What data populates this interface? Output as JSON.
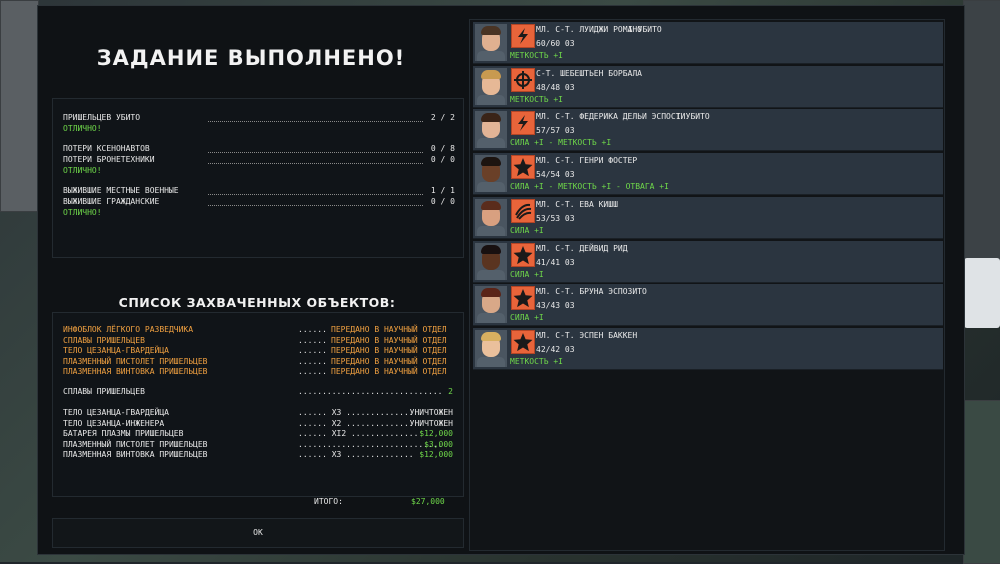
{
  "title": "ЗАДАНИЕ ВЫПОЛНЕНО!",
  "stats": {
    "aliens_killed": {
      "label": "ПРИШЕЛЬЦЕВ УБИТО",
      "value": "2 / 2",
      "rating": "ОТЛИЧНО!"
    },
    "xenonaut_losses": {
      "label": "ПОТЕРИ КСЕНОНАВТОВ",
      "value": "0 / 8"
    },
    "vehicle_losses": {
      "label": "ПОТЕРИ БРОНЕТЕХНИКИ",
      "value": "0 / 0",
      "rating": "ОТЛИЧНО!"
    },
    "local_military": {
      "label": "ВЫЖИВШИЕ МЕСТНЫЕ ВОЕННЫЕ",
      "value": "1 / 1"
    },
    "civilians": {
      "label": "ВЫЖИВШИЕ ГРАЖДАНСКИЕ",
      "value": "0 / 0",
      "rating": "ОТЛИЧНО!"
    }
  },
  "captured": {
    "title": "СПИСОК ЗАХВАЧЕННЫХ ОБЪЕКТОВ:",
    "research": [
      {
        "name": "ИНФОБЛОК ЛЁГКОГО РАЗВЕДЧИКА",
        "dots": "......",
        "status": "ПЕРЕДАНО В НАУЧНЫЙ ОТДЕЛ"
      },
      {
        "name": "СПЛАВЫ ПРИШЕЛЬЦЕВ",
        "dots": "......",
        "status": "ПЕРЕДАНО В НАУЧНЫЙ ОТДЕЛ"
      },
      {
        "name": "ТЕЛО ЦЕЗАНЦА-ГВАРДЕЙЦА",
        "dots": "......",
        "status": "ПЕРЕДАНО В НАУЧНЫЙ ОТДЕЛ"
      },
      {
        "name": "ПЛАЗМЕННЫЙ ПИСТОЛЕТ ПРИШЕЛЬЦЕВ",
        "dots": "......",
        "status": "ПЕРЕДАНО В НАУЧНЫЙ ОТДЕЛ"
      },
      {
        "name": "ПЛАЗМЕННАЯ ВИНТОВКА ПРИШЕЛЬЦЕВ",
        "dots": "......",
        "status": "ПЕРЕДАНО В НАУЧНЫЙ ОТДЕЛ"
      }
    ],
    "alloys": {
      "name": "СПЛАВЫ ПРИШЕЛЬЦЕВ",
      "dots": "..............................",
      "value": "2"
    },
    "sold": [
      {
        "name": "ТЕЛО ЦЕЗАНЦА-ГВАРДЕЙЦА",
        "qty": "...... X3 ..............",
        "result": "УНИЧТОЖЕН",
        "green": false
      },
      {
        "name": "ТЕЛО ЦЕЗАНЦА-ИНЖЕНЕРА",
        "qty": "...... X2 ..............",
        "result": "УНИЧТОЖЕН",
        "green": false
      },
      {
        "name": "БАТАРЕЯ ПЛАЗМЫ ПРИШЕЛЬЦЕВ",
        "qty": "...... XI2 ..............",
        "result": "$12,000",
        "green": true
      },
      {
        "name": "ПЛАЗМЕННЫЙ ПИСТОЛЕТ ПРИШЕЛЬЦЕВ",
        "qty": "..............................",
        "result": "$3,000",
        "green": true
      },
      {
        "name": "ПЛАЗМЕННАЯ ВИНТОВКА ПРИШЕЛЬЦЕВ",
        "qty": "...... X3 ..............",
        "result": "$12,000",
        "green": true
      }
    ]
  },
  "total": {
    "label": "ИТОГО:",
    "value": "$27,000"
  },
  "ok_label": "ОК",
  "soldiers": [
    {
      "name": "МЛ. С-Т. ЛУИДЖИ РОМАНО",
      "kills": "I УБИТО",
      "hp": "60/60 03",
      "bonus": "МЕТКОСТЬ +I",
      "icon": "lightning-icon",
      "skin": "#e0b090",
      "hair": "#4a3424"
    },
    {
      "name": "С-Т. ШЕБЕШТЬЕН БОРБАЛА",
      "kills": "",
      "hp": "48/48 03",
      "bonus": "МЕТКОСТЬ +I",
      "icon": "crosshair-icon",
      "skin": "#e6b896",
      "hair": "#c89a50"
    },
    {
      "name": "МЛ. С-Т. ФЕДЕРИКА ДЕЛЬИ ЭСПОСТИ",
      "kills": "I УБИТО",
      "hp": "57/57 03",
      "bonus": "СИЛА +I  -  МЕТКОСТЬ +I",
      "icon": "lightning-icon",
      "skin": "#e2b496",
      "hair": "#3a2418"
    },
    {
      "name": "МЛ. С-Т. ГЕНРИ ФОСТЕР",
      "kills": "",
      "hp": "54/54 03",
      "bonus": "СИЛА +I  -  МЕТКОСТЬ +I  -  ОТВАГА +I",
      "icon": "star-icon",
      "skin": "#6a4028",
      "hair": "#1c1410"
    },
    {
      "name": "МЛ. С-Т. ЕВА КИШШ",
      "kills": "",
      "hp": "53/53 03",
      "bonus": "СИЛА +I",
      "icon": "claw-icon",
      "skin": "#d8a080",
      "hair": "#5a2c1c"
    },
    {
      "name": "МЛ. С-Т. ДЕЙВИД РИД",
      "kills": "",
      "hp": "41/41 03",
      "bonus": "СИЛА +I",
      "icon": "star-icon",
      "skin": "#5a3420",
      "hair": "#181010"
    },
    {
      "name": "МЛ. С-Т. БРУНА ЭСПОЗИТО",
      "kills": "",
      "hp": "43/43 03",
      "bonus": "СИЛА +I",
      "icon": "star-icon",
      "skin": "#d8a888",
      "hair": "#5a2418"
    },
    {
      "name": "МЛ. С-Т. ЭСПЕН БАККЕН",
      "kills": "",
      "hp": "42/42 03",
      "bonus": "МЕТКОСТЬ +I",
      "icon": "star-icon",
      "skin": "#eac09c",
      "hair": "#d8b060"
    }
  ]
}
